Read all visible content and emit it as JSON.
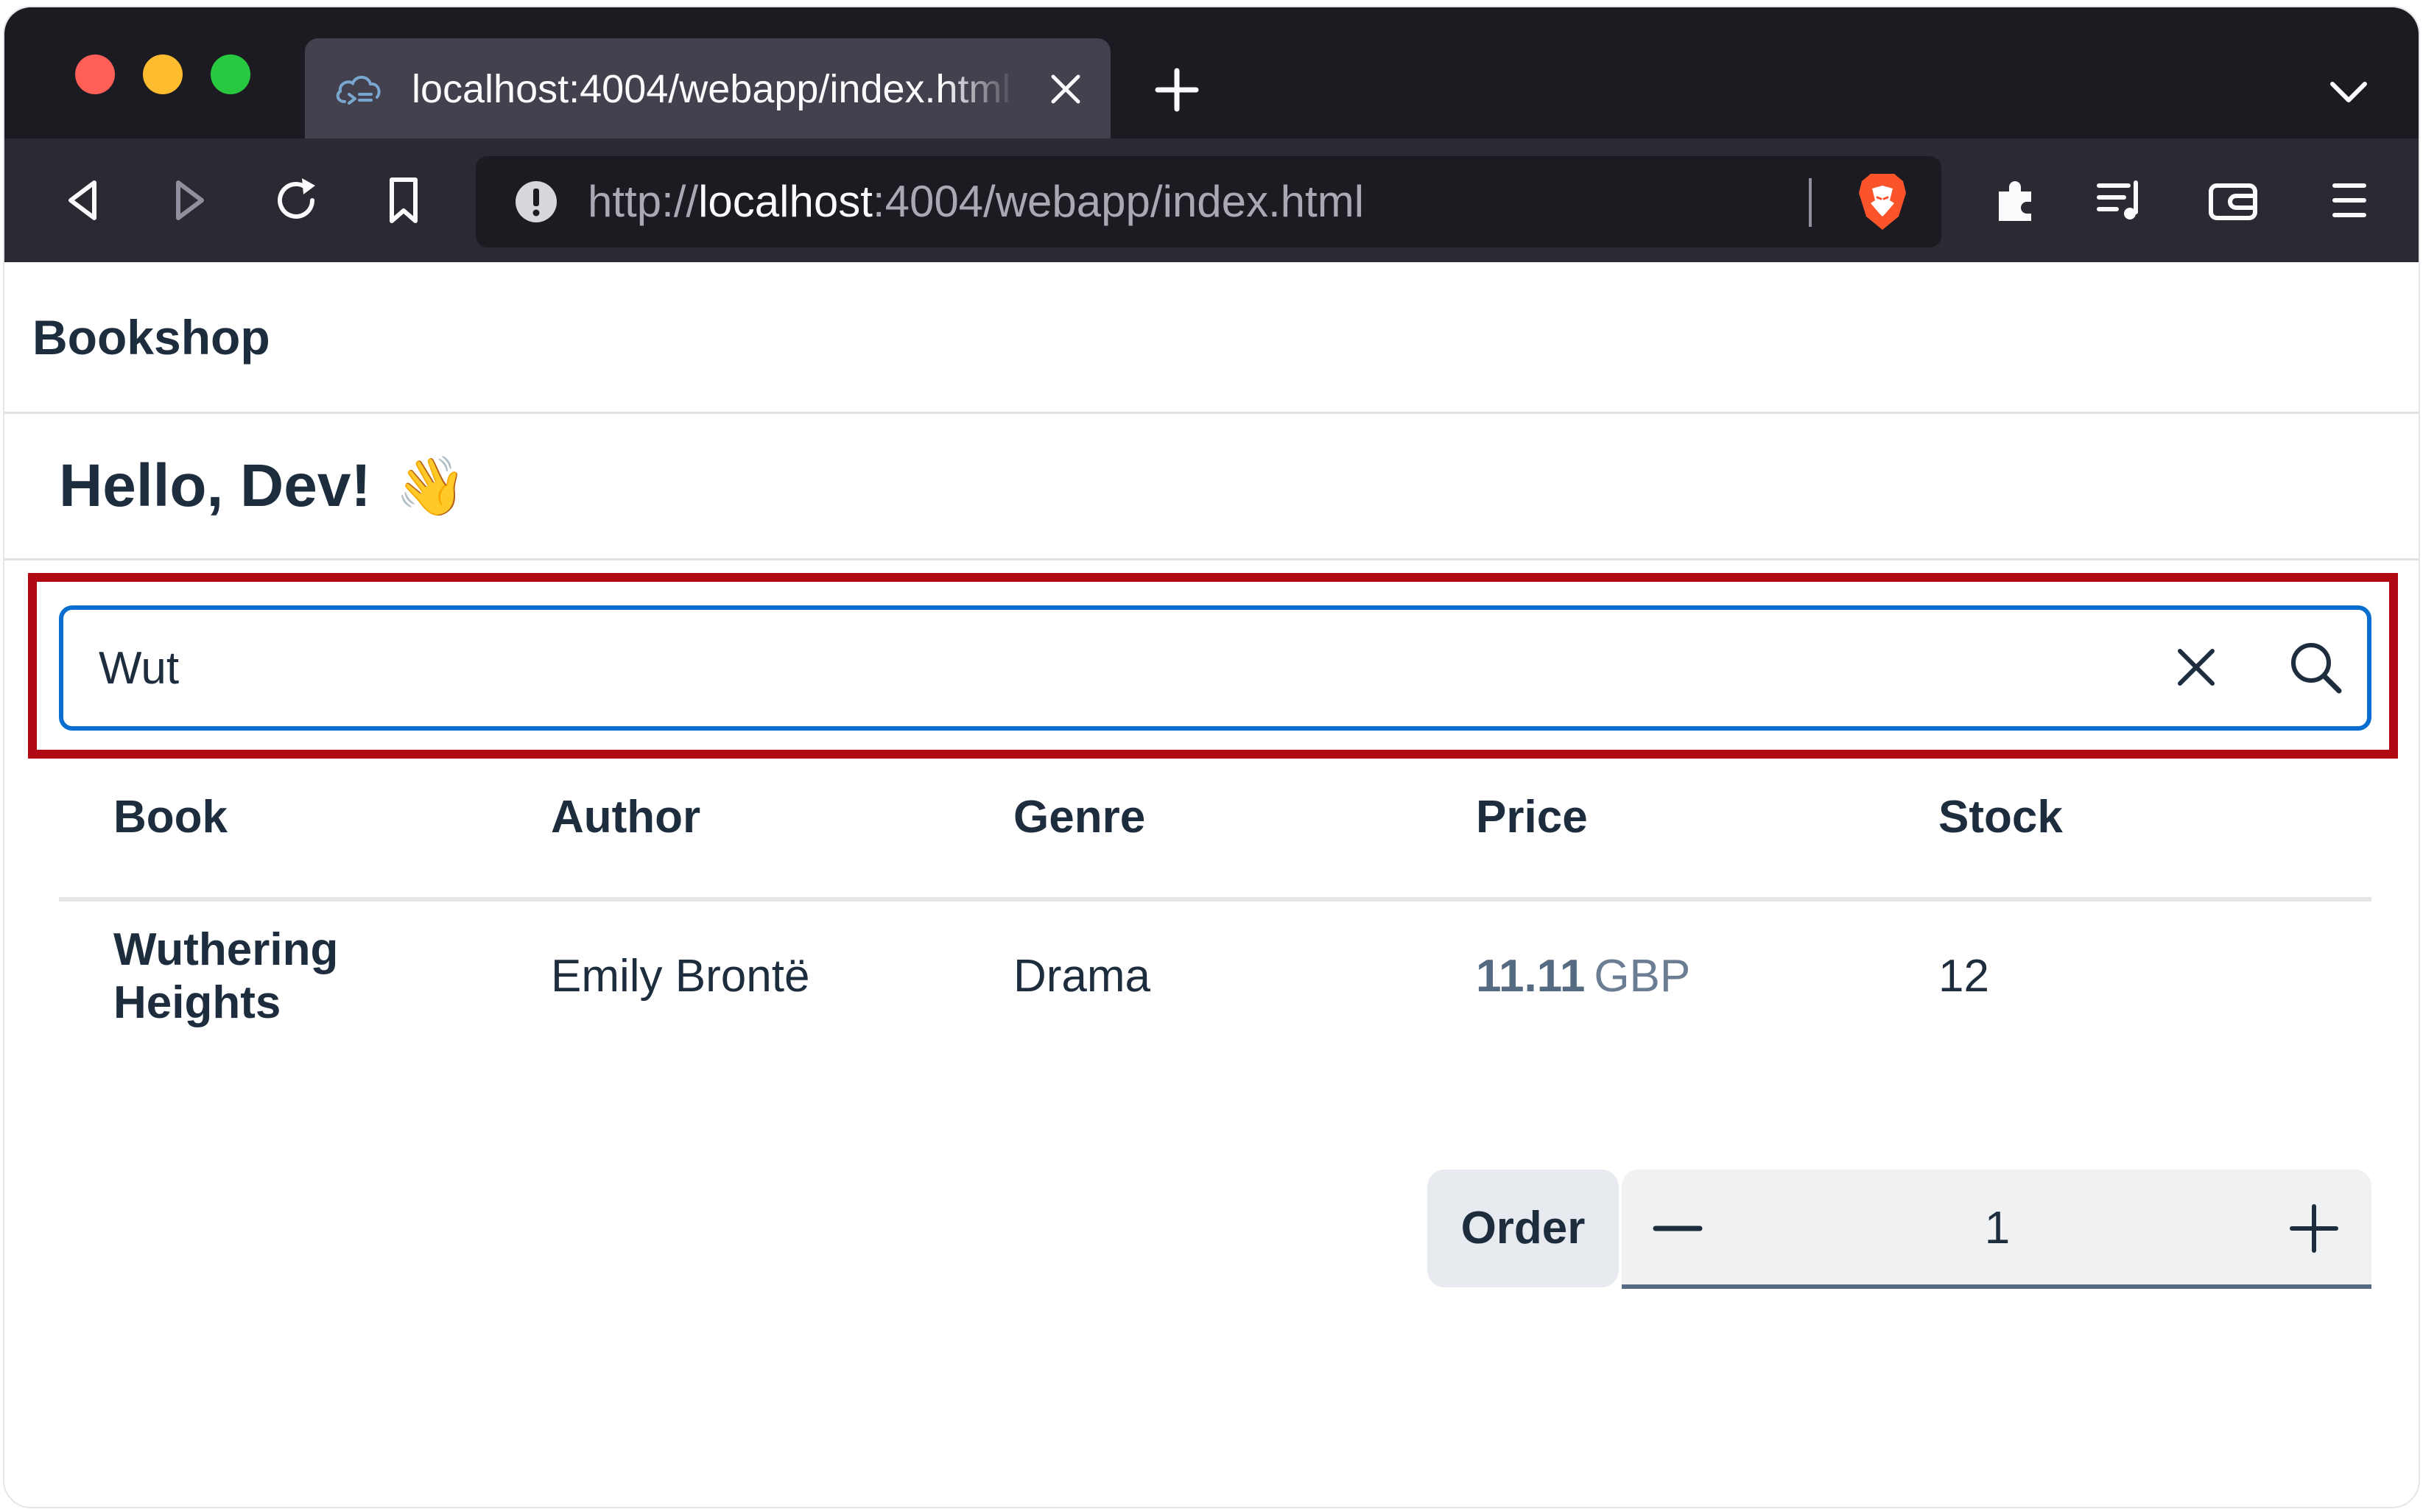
{
  "browser": {
    "tab": {
      "title": "localhost:4004/webapp/index.html",
      "favicon": "cloud-code-icon"
    },
    "url": {
      "scheme": "http://",
      "host": "localhost",
      "rest": ":4004/webapp/index.html"
    }
  },
  "app": {
    "title": "Bookshop",
    "greeting": "Hello, Dev!",
    "greeting_emoji": "👋"
  },
  "search": {
    "value": "Wut",
    "placeholder": ""
  },
  "table": {
    "columns": [
      "Book",
      "Author",
      "Genre",
      "Price",
      "Stock"
    ],
    "rows": [
      {
        "book_line1": "Wuthering",
        "book_line2": "Heights",
        "author": "Emily Brontë",
        "genre": "Drama",
        "price": "11.11",
        "currency": "GBP",
        "stock": "12"
      }
    ]
  },
  "order": {
    "button_label": "Order",
    "quantity": "1"
  },
  "colors": {
    "accent": "#0a6ed1",
    "highlight": "#b00713",
    "text": "#1d2d3e"
  }
}
